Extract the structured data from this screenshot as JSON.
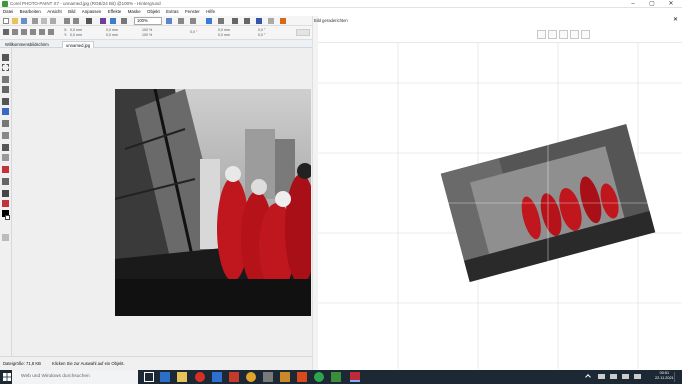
{
  "window": {
    "title": "Corel PHOTO-PAINT X7 - unnamed.jpg (RGB/24 Bit) @100% - Hintergrund"
  },
  "menu": [
    "Datei",
    "Bearbeiten",
    "Ansicht",
    "Bild",
    "Anpassen",
    "Effekte",
    "Maske",
    "Objekt",
    "Extras",
    "Fenster",
    "Hilfe"
  ],
  "toolbar": {
    "zoom_value": "100%"
  },
  "propbar": {
    "x_label": "X:",
    "x_value": "0,0 mm",
    "y_label": "Y:",
    "y_value": "0,0 mm",
    "w_value": "0,0 mm",
    "h_value": "0,0 mm",
    "pct_w": "100 %",
    "pct_h": "100 %",
    "angle": "0,0 °",
    "c1": "0,0 mm",
    "c2": "0,0 mm",
    "c3": "0,0 °",
    "c4": "0,0 °"
  },
  "tabs": [
    "Willkommensbildschirm",
    "unnamed.jpg"
  ],
  "status": {
    "size": "Dateigröße: 71,8 KB",
    "message": "Klicken Sie zur Auswahl auf ein Objekt."
  },
  "dialog": {
    "title": "Bild geraderichten"
  },
  "taskbar": {
    "search_placeholder": "Web und Windows durchsuchen",
    "time": "00:51",
    "date": "22.11.2021"
  },
  "icons": {
    "windows": "windows-logo",
    "search": "search-icon"
  }
}
